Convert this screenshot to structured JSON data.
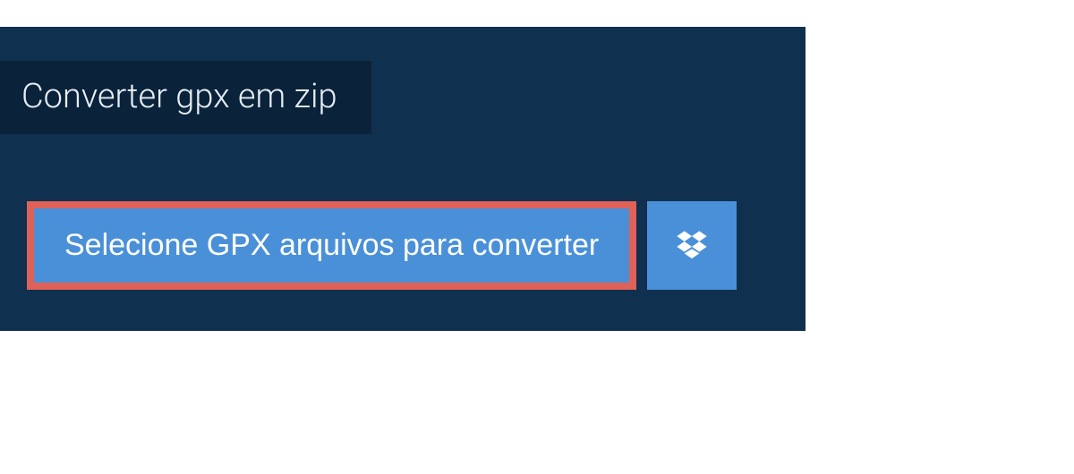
{
  "header": {
    "tab_label": "Converter gpx em zip"
  },
  "upload": {
    "select_label": "Selecione GPX arquivos para converter",
    "dropbox_icon_name": "dropbox-icon"
  },
  "colors": {
    "panel_bg": "#10304f",
    "tab_bg": "#0a233b",
    "button_bg": "#4a90d9",
    "highlight_border": "#df6157"
  }
}
